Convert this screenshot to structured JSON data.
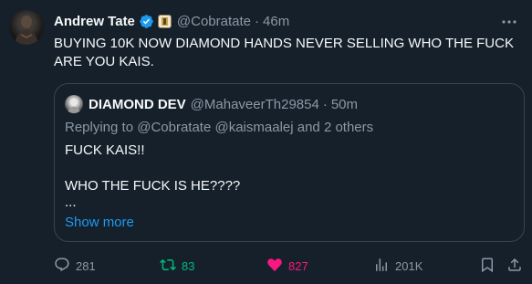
{
  "tweet": {
    "author_name": "Andrew Tate",
    "handle": "@Cobratate",
    "time": "46m",
    "separator": "·",
    "text": "BUYING 10K NOW DIAMOND HANDS NEVER SELLING WHO THE FUCK ARE YOU KAIS."
  },
  "quote": {
    "author_name": "DIAMOND DEV",
    "handle": "@MahaveerTh29854",
    "time": "50m",
    "separator": "·",
    "replying_prefix": "Replying to",
    "replying_mentions": "@Cobratate @kaismaalej",
    "replying_suffix": "and 2 others",
    "lines": [
      "FUCK KAIS!!",
      "WHO THE FUCK IS HE????",
      "..."
    ],
    "show_more": "Show more"
  },
  "actions": {
    "replies": "281",
    "retweets": "83",
    "likes": "827",
    "views": "201K"
  },
  "colors": {
    "background": "#15202b",
    "text": "#f7f9f9",
    "muted": "#8b98a5",
    "link": "#1d9bf0",
    "retweet": "#00ba7c",
    "like": "#f91880",
    "border": "#38444d"
  }
}
